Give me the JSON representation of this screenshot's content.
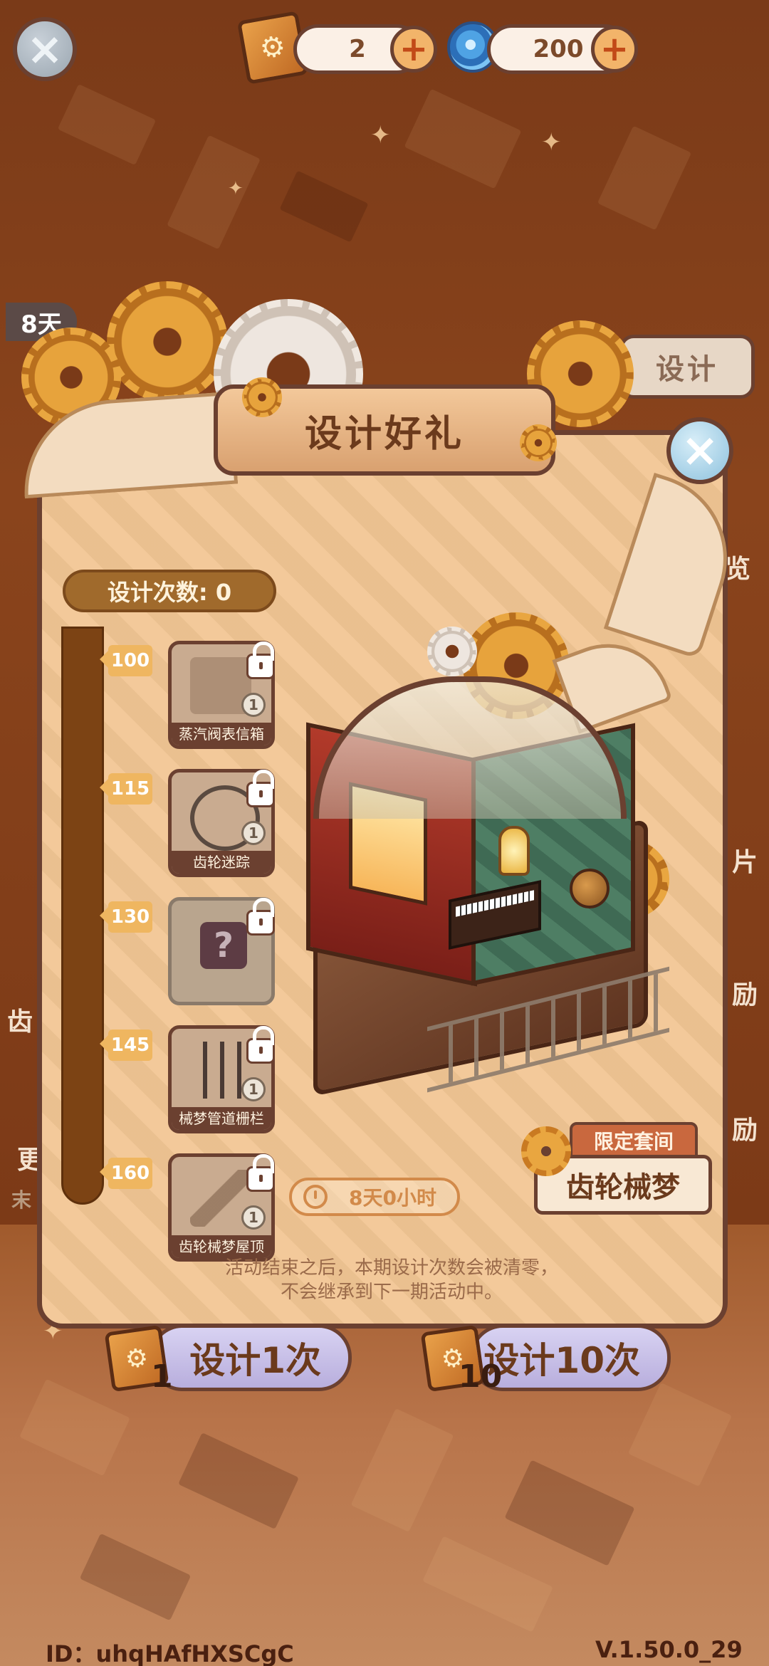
{
  "top_bar": {
    "tickets": "2",
    "gems": "200",
    "plus": "+"
  },
  "background": {
    "days_left": "8天",
    "design_button": "设计",
    "side_labels": [
      "览",
      "片",
      "励",
      "励",
      "齿",
      "更",
      "末"
    ]
  },
  "popup": {
    "title": "设计好礼",
    "close": "×",
    "design_count": "设计次数: 0",
    "milestones": [
      {
        "threshold": "100",
        "name": "蒸汽阀表信箱",
        "qty": "1",
        "locked": true
      },
      {
        "threshold": "115",
        "name": "齿轮迷踪",
        "qty": "1",
        "locked": true
      },
      {
        "threshold": "130",
        "name": "",
        "qty": "",
        "locked": true,
        "mystery": "?"
      },
      {
        "threshold": "145",
        "name": "械梦管道栅栏",
        "qty": "1",
        "locked": true
      },
      {
        "threshold": "160",
        "name": "齿轮械梦屋顶",
        "qty": "1",
        "locked": true
      }
    ],
    "timer": "8天0小时",
    "set_tag": "限定套间",
    "set_name": "齿轮械梦",
    "note_line1": "活动结束之后，本期设计次数会被清零，",
    "note_line2": "不会继承到下一期活动中。"
  },
  "actions": {
    "design_once": "设计1次",
    "design_once_cost": "1",
    "design_ten": "设计10次",
    "design_ten_cost": "10"
  },
  "footer": {
    "id": "ID：uhqHAfHXSCgC",
    "version": "V.1.50.0_29"
  },
  "colors": {
    "background": "#7a3a18",
    "popup": "#f2c694",
    "outline": "#6b4030",
    "button": "#c8bfea",
    "milestone": "#efb660"
  }
}
